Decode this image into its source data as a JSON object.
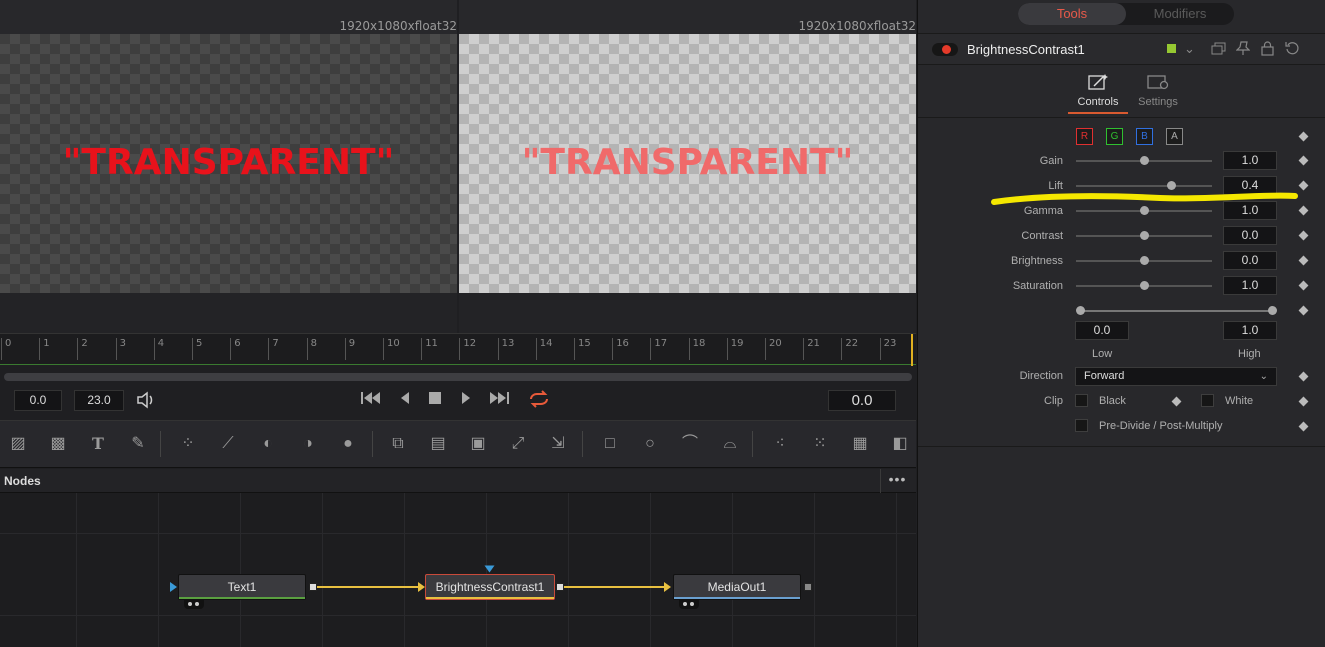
{
  "viewers": {
    "left": {
      "resolution": "1920x1080xfloat32",
      "text": "\"TRANSPARENT\""
    },
    "right": {
      "resolution": "1920x1080xfloat32",
      "text": "\"TRANSPARENT\""
    }
  },
  "timeline": {
    "ticks": [
      "0",
      "1",
      "2",
      "3",
      "4",
      "5",
      "6",
      "7",
      "8",
      "9",
      "10",
      "11",
      "12",
      "13",
      "14",
      "15",
      "16",
      "17",
      "18",
      "19",
      "20",
      "21",
      "22",
      "23"
    ],
    "start": "0.0",
    "end": "23.0",
    "current": "0.0"
  },
  "toolbar": {
    "icons": [
      "background-icon",
      "fast-noise-icon",
      "text-icon",
      "paint-icon",
      "particles-icon",
      "color-curves-icon",
      "brightness-contrast-icon",
      "color-corrector-icon",
      "blur-icon",
      "merge-icon",
      "loader-icon",
      "saver-icon",
      "transform-icon",
      "resize-icon",
      "mask-rectangle-icon",
      "mask-ellipse-icon",
      "mask-polygon-icon",
      "mask-bspline-icon",
      "pemitter-icon",
      "prender-icon",
      "image-plane-icon",
      "shape3d-icon"
    ]
  },
  "nodes": {
    "title": "Nodes",
    "menu": "•••",
    "items": [
      {
        "label": "Text1",
        "bar_color": "#5aa040"
      },
      {
        "label": "BrightnessContrast1",
        "bar_color": "#e8c040"
      },
      {
        "label": "MediaOut1",
        "bar_color": "#6aa0d0"
      }
    ]
  },
  "inspector": {
    "tabs": {
      "tools": "Tools",
      "modifiers": "Modifiers"
    },
    "tool_name": "BrightnessContrast1",
    "subtabs": {
      "controls": "Controls",
      "settings": "Settings"
    },
    "channels": [
      "R",
      "G",
      "B",
      "A"
    ],
    "channel_colors": [
      "#e03030",
      "#30c030",
      "#3070e0",
      "#9a9a9a"
    ],
    "params": [
      {
        "label": "Gain",
        "value": "1.0",
        "slider": 0.5
      },
      {
        "label": "Lift",
        "value": "0.4",
        "slider": 0.7
      },
      {
        "label": "Gamma",
        "value": "1.0",
        "slider": 0.5
      },
      {
        "label": "Contrast",
        "value": "0.0",
        "slider": 0.5
      },
      {
        "label": "Brightness",
        "value": "0.0",
        "slider": 0.5
      },
      {
        "label": "Saturation",
        "value": "1.0",
        "slider": 0.5
      }
    ],
    "range": {
      "low": "0.0",
      "high": "1.0",
      "low_label": "Low",
      "high_label": "High"
    },
    "direction": {
      "label": "Direction",
      "value": "Forward"
    },
    "clip": {
      "label": "Clip",
      "black": "Black",
      "white": "White"
    },
    "predivide": "Pre-Divide / Post-Multiply",
    "highlight_color": "#f5e800"
  }
}
